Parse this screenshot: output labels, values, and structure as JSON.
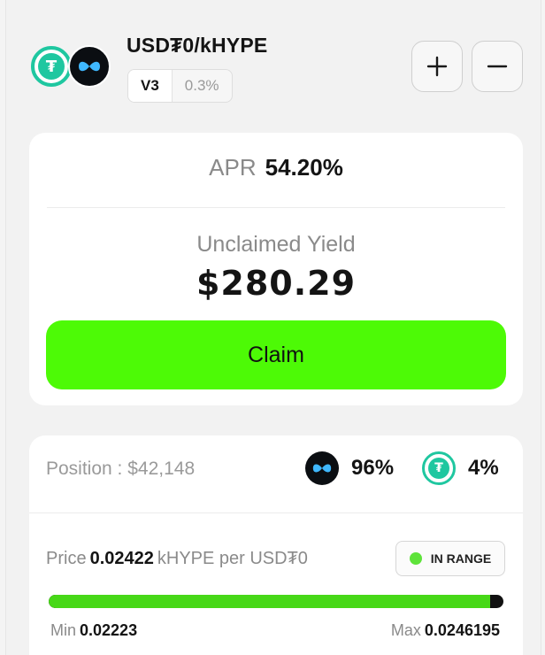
{
  "pair": {
    "title": "USD₮0/kHYPE",
    "version": "V3",
    "fee": "0.3%",
    "token0_icon": "usdt0-token-icon",
    "token1_icon": "khype-token-icon"
  },
  "actions": {
    "add_icon": "plus-icon",
    "remove_icon": "minus-icon"
  },
  "yield_card": {
    "apr_label": "APR",
    "apr_value": "54.20%",
    "unclaimed_label": "Unclaimed Yield",
    "unclaimed_value": "$280.29",
    "claim_label": "Claim"
  },
  "position_card": {
    "position_label": "Position : $42,148",
    "token1_share": "96%",
    "token0_share": "4%",
    "price_label": "Price",
    "price_value": "0.02422",
    "price_unit": "kHYPE per USD₮0",
    "range_status": "IN RANGE",
    "range_position": 0.97,
    "min_label": "Min",
    "min_value": "0.02223",
    "max_label": "Max",
    "max_value": "0.0246195"
  },
  "colors": {
    "accent_green": "#4dfa06",
    "usdt_teal": "#1fc7a0",
    "range_fill": "#47d817"
  }
}
